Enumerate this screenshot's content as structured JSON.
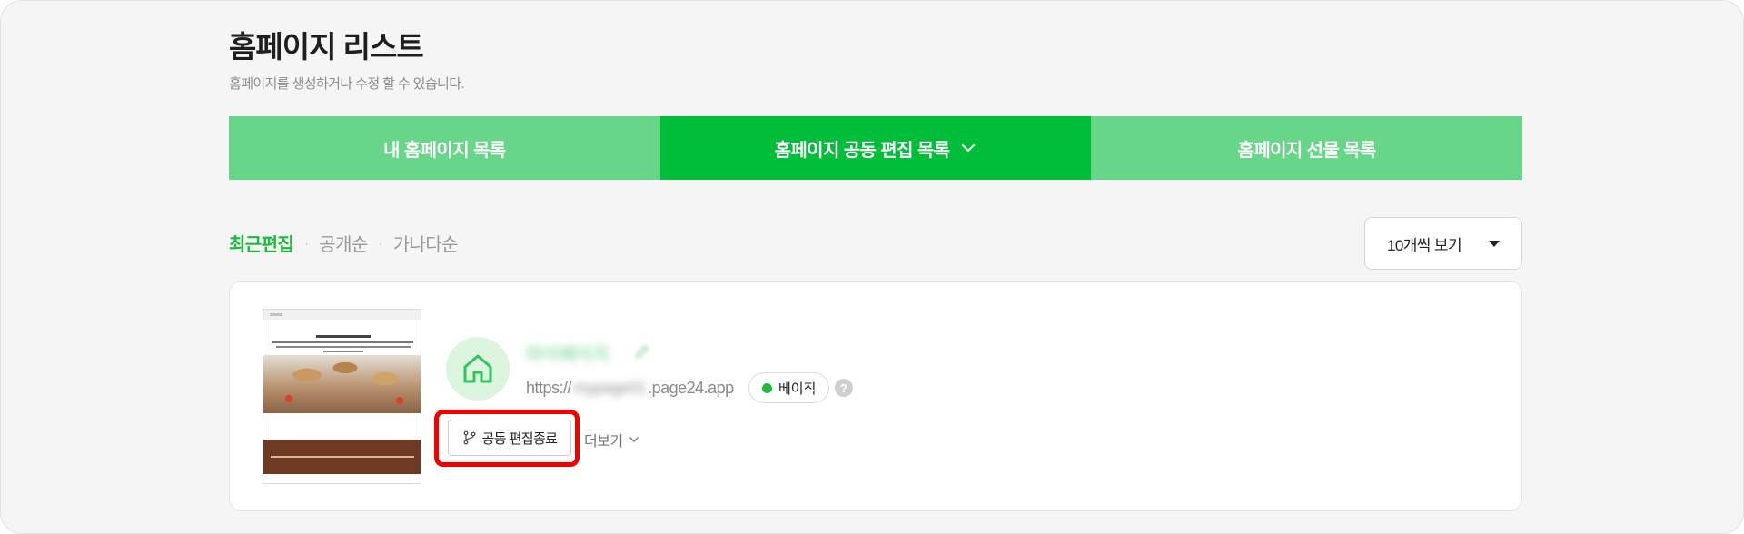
{
  "header": {
    "title": "홈페이지 리스트",
    "subtitle": "홈페이지를 생성하거나 수정 할 수 있습니다."
  },
  "tabs": [
    {
      "label": "내 홈페이지 목록",
      "active": false
    },
    {
      "label": "홈페이지 공동 편집 목록",
      "active": true,
      "icon": "chevron-down-icon"
    },
    {
      "label": "홈페이지 선물 목록",
      "active": false
    }
  ],
  "sort": {
    "items": [
      "최근편집",
      "공개순",
      "가나다순"
    ],
    "selected": "최근편집",
    "separator": "·"
  },
  "view_select": {
    "value": "10개씩 보기"
  },
  "site_card": {
    "name": "마이페이지",
    "url_prefix": "https://",
    "url_hidden": "mypage01",
    "url_suffix": ".page24.app",
    "plan_badge": "베이직",
    "help_icon_text": "?",
    "end_coedit_button": "공동 편집종료",
    "more_label": "더보기"
  },
  "colors": {
    "accent": "#00be3a",
    "tab_inactive": "#67d688",
    "sort_active": "#1fba3b",
    "highlight": "#f20000"
  }
}
